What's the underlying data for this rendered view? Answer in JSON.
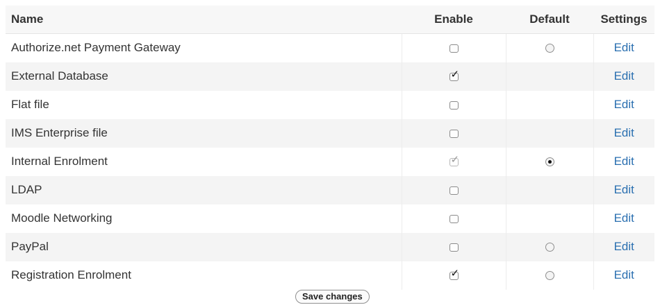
{
  "headers": {
    "name": "Name",
    "enable": "Enable",
    "default": "Default",
    "settings": "Settings"
  },
  "plugins": [
    {
      "name": "Authorize.net Payment Gateway",
      "enabled": false,
      "enable_locked": false,
      "has_default": true,
      "is_default": false,
      "settings_label": "Edit"
    },
    {
      "name": "External Database",
      "enabled": true,
      "enable_locked": false,
      "has_default": false,
      "is_default": false,
      "settings_label": "Edit"
    },
    {
      "name": "Flat file",
      "enabled": false,
      "enable_locked": false,
      "has_default": false,
      "is_default": false,
      "settings_label": "Edit"
    },
    {
      "name": "IMS Enterprise file",
      "enabled": false,
      "enable_locked": false,
      "has_default": false,
      "is_default": false,
      "settings_label": "Edit"
    },
    {
      "name": "Internal Enrolment",
      "enabled": true,
      "enable_locked": true,
      "has_default": true,
      "is_default": true,
      "settings_label": "Edit"
    },
    {
      "name": "LDAP",
      "enabled": false,
      "enable_locked": false,
      "has_default": false,
      "is_default": false,
      "settings_label": "Edit"
    },
    {
      "name": "Moodle Networking",
      "enabled": false,
      "enable_locked": false,
      "has_default": false,
      "is_default": false,
      "settings_label": "Edit"
    },
    {
      "name": "PayPal",
      "enabled": false,
      "enable_locked": false,
      "has_default": true,
      "is_default": false,
      "settings_label": "Edit"
    },
    {
      "name": "Registration Enrolment",
      "enabled": true,
      "enable_locked": false,
      "has_default": true,
      "is_default": false,
      "settings_label": "Edit"
    }
  ],
  "save_button_label": "Save changes",
  "colors": {
    "link": "#2a6fb0",
    "header_bg": "#f7f7f7",
    "stripe_bg": "#f4f4f4"
  }
}
